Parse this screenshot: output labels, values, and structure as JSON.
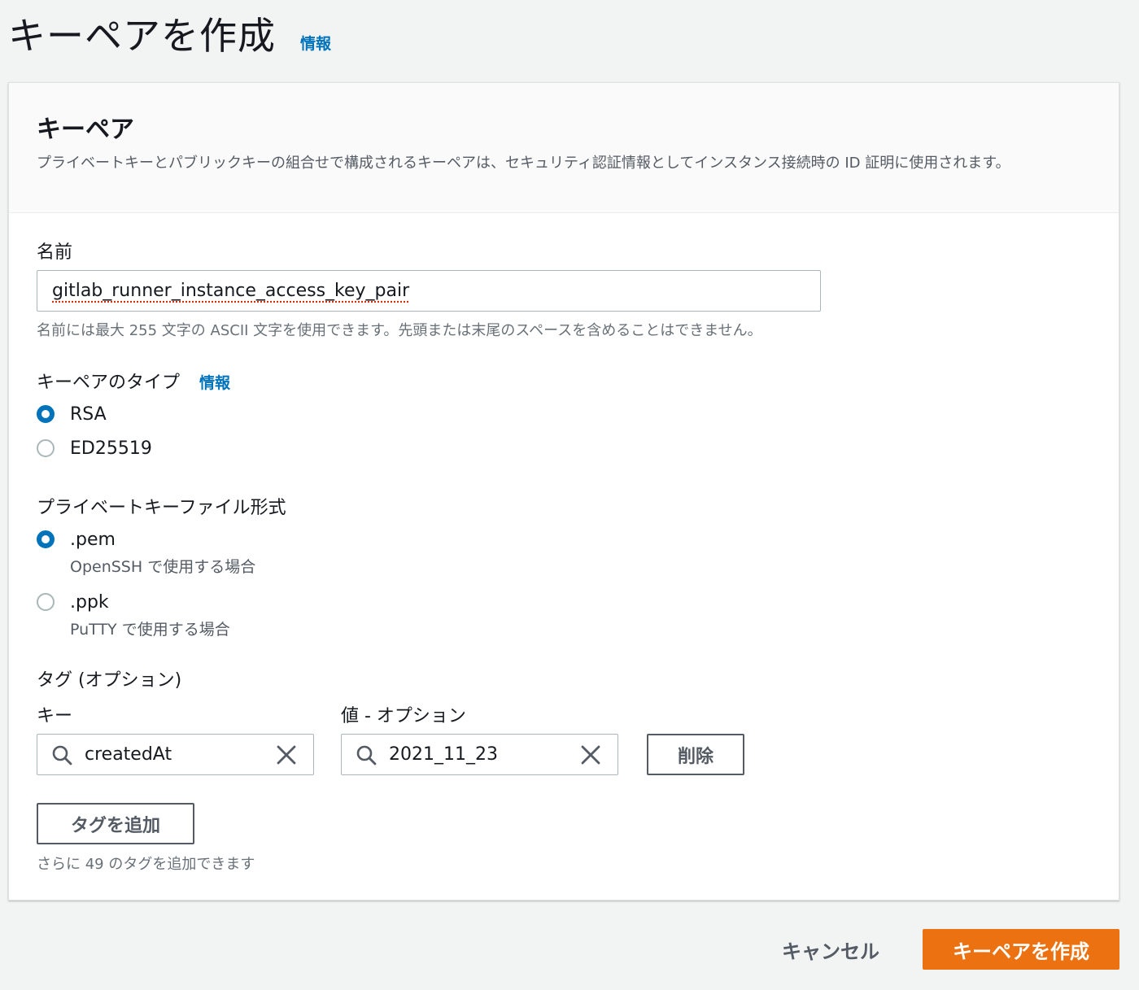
{
  "page": {
    "title": "キーペアを作成",
    "info_link": "情報"
  },
  "panel": {
    "title": "キーペア",
    "description": "プライベートキーとパブリックキーの組合せで構成されるキーペアは、セキュリティ認証情報としてインスタンス接続時の ID 証明に使用されます。"
  },
  "name_field": {
    "label": "名前",
    "value": "gitlab_runner_instance_access_key_pair",
    "hint": "名前には最大 255 文字の ASCII 文字を使用できます。先頭または末尾のスペースを含めることはできません。"
  },
  "key_type": {
    "label": "キーペアのタイプ",
    "info_link": "情報",
    "options": [
      {
        "label": "RSA",
        "selected": true
      },
      {
        "label": "ED25519",
        "selected": false
      }
    ]
  },
  "file_format": {
    "label": "プライベートキーファイル形式",
    "options": [
      {
        "label": ".pem",
        "sub": "OpenSSH で使用する場合",
        "selected": true
      },
      {
        "label": ".ppk",
        "sub": "PuTTY で使用する場合",
        "selected": false
      }
    ]
  },
  "tags": {
    "label": "タグ (オプション)",
    "key_label": "キー",
    "value_label": "値 - オプション",
    "rows": [
      {
        "key": "createdAt",
        "value": "2021_11_23"
      }
    ],
    "remove_button": "削除",
    "add_button": "タグを追加",
    "remaining_hint": "さらに 49 のタグを追加できます"
  },
  "footer": {
    "cancel": "キャンセル",
    "create": "キーペアを作成"
  },
  "colors": {
    "accent": "#0073bb",
    "primary_button": "#ec7211",
    "background": "#f2f3f3"
  },
  "icons": {
    "search": "search-icon",
    "clear": "close-icon"
  }
}
